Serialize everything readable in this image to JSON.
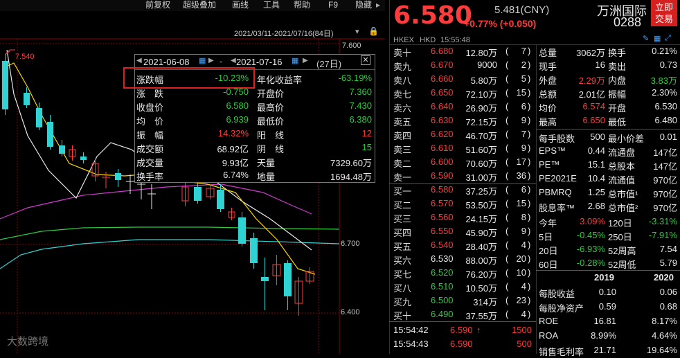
{
  "menu": [
    "前复权",
    "超级叠加",
    "画线",
    "工具",
    "帮助",
    "F9",
    "隐藏"
  ],
  "chart": {
    "date_range": "2021/03/11-2021/07/16(84日)",
    "y_labels": [
      "7.600",
      "6.700",
      "6.400"
    ],
    "max_label": "7.540",
    "watermark": "大数跨境"
  },
  "stats_panel": {
    "start_date": "2021-06-08",
    "end_date": "2021-07-16",
    "days": "(27日)",
    "rows": [
      {
        "l1": "涨跌幅",
        "v1": "-10.23%",
        "c1": "green",
        "l2": "年化收益率",
        "v2": "-63.19%",
        "c2": "green"
      },
      {
        "l1": "涨　跌",
        "v1": "-0.750",
        "c1": "green",
        "l2": "开盘价",
        "v2": "7.360",
        "c2": "green"
      },
      {
        "l1": "收盘价",
        "v1": "6.580",
        "c1": "green",
        "l2": "最高价",
        "v2": "7.430",
        "c2": "green"
      },
      {
        "l1": "均　价",
        "v1": "6.939",
        "c1": "green",
        "l2": "最低价",
        "v2": "6.380",
        "c2": "green"
      },
      {
        "l1": "振　幅",
        "v1": "14.32%",
        "c1": "red",
        "l2": "阳　线",
        "v2": "12",
        "c2": "red"
      },
      {
        "l1": "成交额",
        "v1": "68.92亿",
        "c1": "white",
        "l2": "阴　线",
        "v2": "15",
        "c2": "green"
      },
      {
        "l1": "成交量",
        "v1": "9.93亿",
        "c1": "white",
        "l2": "天量",
        "v2": "7329.60万",
        "c2": "white"
      },
      {
        "l1": "换手率",
        "v1": "6.74%",
        "c1": "white",
        "l2": "地量",
        "v2": "1694.48万",
        "c2": "white"
      }
    ]
  },
  "quote": {
    "price": "6.580",
    "cny": "5.481(CNY)",
    "change": "+0.77% (+0.050)",
    "name": "万洲国际",
    "code": "0288",
    "trade_btn_line1": "立即",
    "trade_btn_line2": "交易",
    "market": "HKEX",
    "currency": "HKD",
    "time": "15:55:48"
  },
  "asks": [
    {
      "label": "卖十",
      "price": "6.680",
      "vol": "12.80万",
      "n": "7"
    },
    {
      "label": "卖九",
      "price": "6.670",
      "vol": "9000",
      "n": "2"
    },
    {
      "label": "卖八",
      "price": "6.660",
      "vol": "5.80万",
      "n": "5"
    },
    {
      "label": "卖七",
      "price": "6.650",
      "vol": "72.10万",
      "n": "15"
    },
    {
      "label": "卖六",
      "price": "6.640",
      "vol": "26.90万",
      "n": "6"
    },
    {
      "label": "卖五",
      "price": "6.630",
      "vol": "72.15万",
      "n": "9"
    },
    {
      "label": "卖四",
      "price": "6.620",
      "vol": "46.70万",
      "n": "7"
    },
    {
      "label": "卖三",
      "price": "6.610",
      "vol": "51.60万",
      "n": "9"
    },
    {
      "label": "卖二",
      "price": "6.600",
      "vol": "70.60万",
      "n": "17"
    },
    {
      "label": "卖一",
      "price": "6.590",
      "vol": "31.00万",
      "n": "36"
    }
  ],
  "bids": [
    {
      "label": "买一",
      "price": "6.580",
      "vol": "37.25万",
      "n": "6"
    },
    {
      "label": "买二",
      "price": "6.570",
      "vol": "53.50万",
      "n": "15"
    },
    {
      "label": "买三",
      "price": "6.560",
      "vol": "24.15万",
      "n": "8"
    },
    {
      "label": "买四",
      "price": "6.550",
      "vol": "45.90万",
      "n": "9"
    },
    {
      "label": "买五",
      "price": "6.540",
      "vol": "28.40万",
      "n": "4"
    },
    {
      "label": "买六",
      "price": "6.530",
      "vol": "88.00万",
      "n": "20"
    },
    {
      "label": "买七",
      "price": "6.520",
      "vol": "76.20万",
      "n": "10"
    },
    {
      "label": "买八",
      "price": "6.510",
      "vol": "10.50万",
      "n": "4"
    },
    {
      "label": "买九",
      "price": "6.500",
      "vol": "314万",
      "n": "23"
    },
    {
      "label": "买十",
      "price": "6.490",
      "vol": "37.55万",
      "n": "4"
    }
  ],
  "ticks": [
    {
      "time": "15:54:42",
      "price": "6.590",
      "arrow": "↑",
      "vol": "1500"
    },
    {
      "time": "15:54:43",
      "price": "6.590",
      "arrow": "",
      "vol": "500"
    }
  ],
  "summary_a": [
    {
      "l1": "总量",
      "v1": "3062万",
      "c1": "white",
      "l2": "换手",
      "v2": "0.21%",
      "c2": "white"
    },
    {
      "l1": "现手",
      "v1": "16",
      "c1": "white",
      "l2": "卖出",
      "v2": "0.73",
      "c2": "white"
    },
    {
      "l1": "外盘",
      "v1": "2.29万",
      "c1": "red",
      "l2": "内盘",
      "v2": "3.83万",
      "c2": "green"
    },
    {
      "l1": "总额",
      "v1": "2.01亿",
      "c1": "white",
      "l2": "振幅",
      "v2": "2.30%",
      "c2": "white"
    },
    {
      "l1": "均价",
      "v1": "6.574",
      "c1": "red",
      "l2": "开盘",
      "v2": "6.530",
      "c2": "white"
    },
    {
      "l1": "最高",
      "v1": "6.650",
      "c1": "red",
      "l2": "最低",
      "v2": "6.480",
      "c2": "white"
    }
  ],
  "summary_b": [
    {
      "l1": "每手股数",
      "v1": "500",
      "c1": "white",
      "l2": "最小价差",
      "v2": "0.01",
      "c2": "white"
    },
    {
      "l1": "EPS™",
      "v1": "0.44",
      "c1": "white",
      "l2": "流通盘",
      "v2": "147亿",
      "c2": "white"
    },
    {
      "l1": "PE™",
      "v1": "15.1",
      "c1": "white",
      "l2": "总股本",
      "v2": "147亿",
      "c2": "white"
    },
    {
      "l1": "PE2021E",
      "v1": "10.4",
      "c1": "white",
      "l2": "流通值",
      "v2": "970亿",
      "c2": "white"
    },
    {
      "l1": "PBMRQ",
      "v1": "1.25",
      "c1": "white",
      "l2": "总市值¹",
      "v2": "970亿",
      "c2": "white"
    },
    {
      "l1": "股息率™",
      "v1": "2.68",
      "c1": "white",
      "l2": "总市值²",
      "v2": "970亿",
      "c2": "white"
    }
  ],
  "perf": [
    {
      "l1": "今年",
      "v1": "3.09%",
      "c1": "red",
      "l2": "120日",
      "v2": "-3.31%",
      "c2": "green"
    },
    {
      "l1": "5日",
      "v1": "-0.45%",
      "c1": "green",
      "l2": "250日",
      "v2": "-7.91%",
      "c2": "green"
    },
    {
      "l1": "20日",
      "v1": "-6.93%",
      "c1": "green",
      "l2": "52周高",
      "v2": "7.54",
      "c2": "white"
    },
    {
      "l1": "60日",
      "v1": "-0.28%",
      "c1": "green",
      "l2": "52周低",
      "v2": "5.79",
      "c2": "white"
    }
  ],
  "fin": {
    "years": [
      "2019",
      "2020"
    ],
    "rows": [
      {
        "label": "每股收益",
        "a": "0.10",
        "b": "0.06"
      },
      {
        "label": "每股净资产",
        "a": "0.59",
        "b": "0.68"
      },
      {
        "label": "ROE",
        "a": "16.81",
        "b": "8.17%"
      },
      {
        "label": "ROA",
        "a": "8.99%",
        "b": "4.64%"
      },
      {
        "label": "销售毛利率",
        "a": "21.71",
        "b": "19.64%"
      }
    ]
  }
}
